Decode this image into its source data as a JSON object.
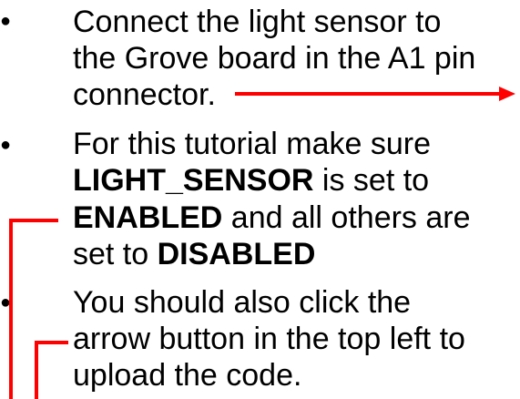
{
  "bullets": [
    {
      "lines": [
        [
          {
            "text": "Connect the light sensor to",
            "bold": false
          }
        ],
        [
          {
            "text": "the Grove board in the A1 pin",
            "bold": false
          }
        ],
        [
          {
            "text": "connector.",
            "bold": false
          }
        ]
      ]
    },
    {
      "lines": [
        [
          {
            "text": "For this tutorial make sure",
            "bold": false
          }
        ],
        [
          {
            "text": "LIGHT_SENSOR",
            "bold": true
          },
          {
            "text": " is set to",
            "bold": false
          }
        ],
        [
          {
            "text": "ENABLED",
            "bold": true
          },
          {
            "text": " and all others are",
            "bold": false
          }
        ],
        [
          {
            "text": "set to ",
            "bold": false
          },
          {
            "text": "DISABLED",
            "bold": true
          }
        ]
      ]
    },
    {
      "lines": [
        [
          {
            "text": "You should also click the",
            "bold": false
          }
        ],
        [
          {
            "text": "arrow button in the top left to",
            "bold": false
          }
        ],
        [
          {
            "text": "upload the code.",
            "bold": false
          }
        ]
      ]
    }
  ],
  "colors": {
    "text": "#000000",
    "annotation": "#ff0000"
  }
}
